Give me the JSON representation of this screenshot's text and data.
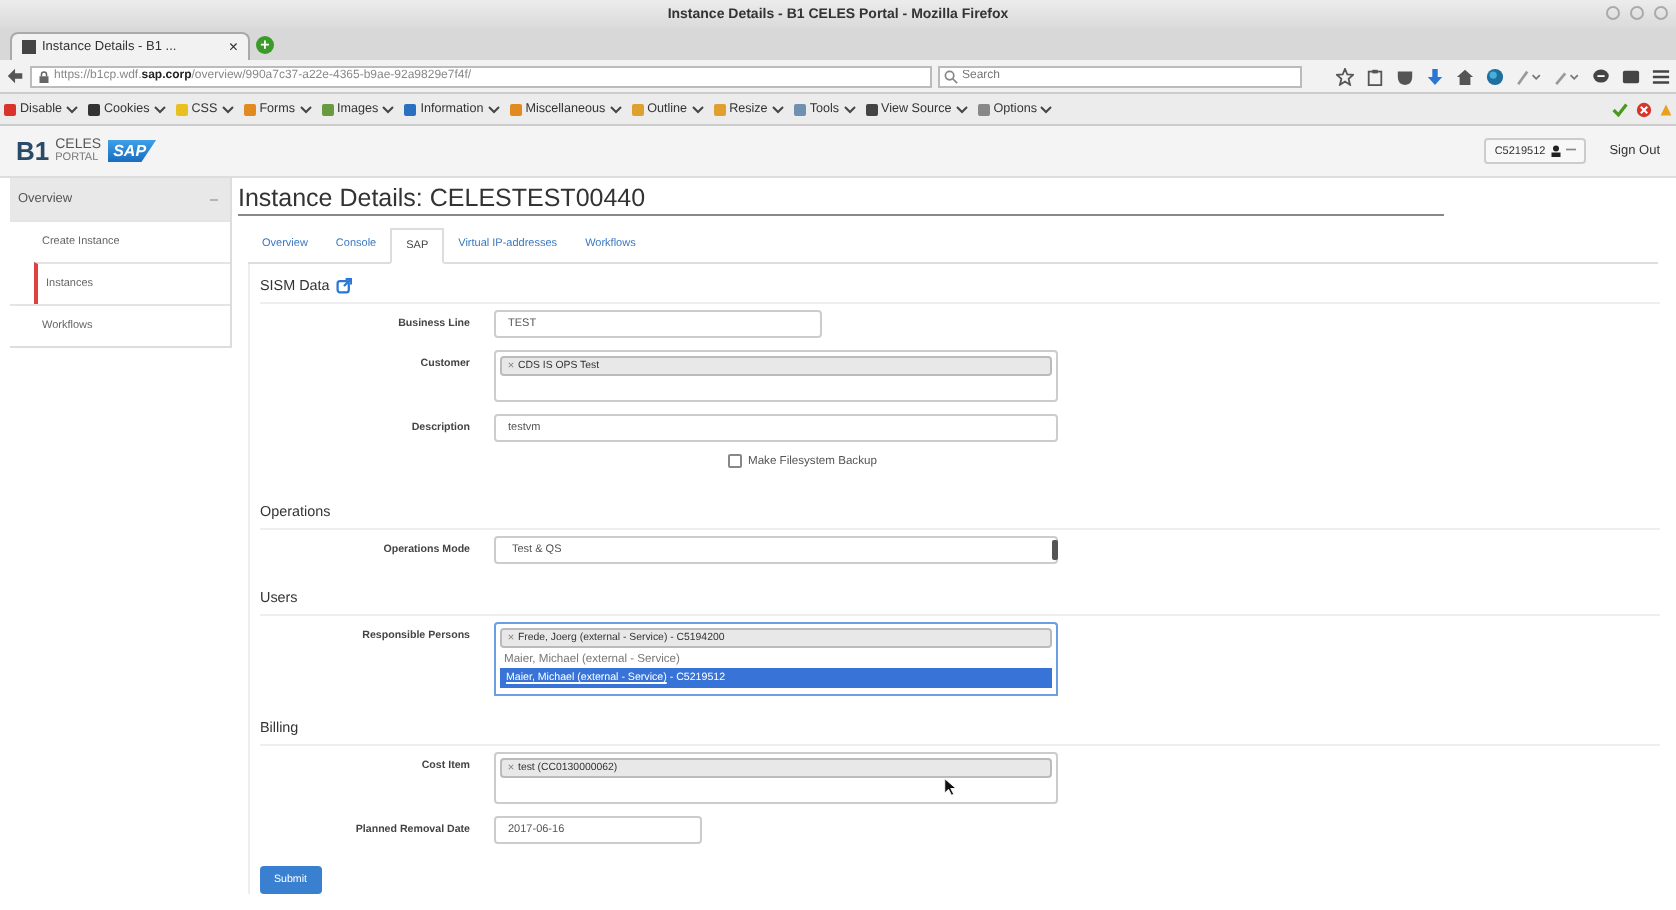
{
  "window": {
    "title": "Instance Details - B1 CELES Portal - Mozilla Firefox"
  },
  "browser_tab": {
    "title": "Instance Details - B1 ...",
    "close": "×",
    "new_tab": "+"
  },
  "url_bar": {
    "url": "https://b1cp.wdf.**sap.corp**/overview/990a7c37-a22e-4365-b9ae-92a9829e7f4f/"
  },
  "search": {
    "placeholder": "Search"
  },
  "dev_toolbar": [
    {
      "label": "Disable",
      "color": "#d9342b"
    },
    {
      "label": "Cookies",
      "color": "#333333"
    },
    {
      "label": "CSS",
      "color": "#e8c020"
    },
    {
      "label": "Forms",
      "color": "#e08a20"
    },
    {
      "label": "Images",
      "color": "#6a9a40"
    },
    {
      "label": "Information",
      "color": "#2a6fc0"
    },
    {
      "label": "Miscellaneous",
      "color": "#e08a20"
    },
    {
      "label": "Outline",
      "color": "#e0a030"
    },
    {
      "label": "Resize",
      "color": "#e0a030"
    },
    {
      "label": "Tools",
      "color": "#7090b0"
    },
    {
      "label": "View Source",
      "color": "#444444"
    },
    {
      "label": "Options",
      "color": "#888888"
    }
  ],
  "header": {
    "logo_main": "B1",
    "logo_top": "CELES",
    "logo_bottom": "PORTAL",
    "sap_logo": "SAP",
    "user": "C5219512",
    "sign_out": "Sign Out"
  },
  "sidebar": {
    "title": "Overview",
    "expanded": true,
    "items": [
      {
        "label": "Create Instance",
        "selected": false
      },
      {
        "label": "Instances",
        "selected": true
      },
      {
        "label": "Workflows",
        "selected": false
      }
    ]
  },
  "page_title": "Instance Details: CELESTEST00440",
  "tabs": [
    {
      "label": "Overview",
      "selected": false
    },
    {
      "label": "Console",
      "selected": false
    },
    {
      "label": "SAP",
      "selected": true
    },
    {
      "label": "Virtual IP-addresses",
      "selected": false
    },
    {
      "label": "Workflows",
      "selected": false
    }
  ],
  "sections": [
    {
      "title": "SISM Data",
      "external_link": true,
      "fields": [
        {
          "kind": "short_text",
          "label": "Business Line",
          "value": "TEST"
        },
        {
          "kind": "tags",
          "label": "Customer",
          "tags": [
            "CDS IS OPS Test"
          ]
        },
        {
          "kind": "text",
          "label": "Description",
          "value": "testvm"
        },
        {
          "kind": "checkbox",
          "text": "Make Filesystem Backup",
          "checked": false
        }
      ]
    },
    {
      "title": "Operations",
      "external_link": false,
      "fields": [
        {
          "kind": "select",
          "label": "Operations Mode",
          "value": "Test & QS"
        }
      ]
    },
    {
      "title": "Users",
      "external_link": false,
      "fields": [
        {
          "kind": "tags",
          "label": "Responsible Persons",
          "tags": [
            "Frede, Joerg (external - Service) - C5194200"
          ],
          "search_text": "Maier, Michael (external - Service)",
          "options": [
            {
              "match": "Maier, Michael (external - Service)",
              "rest": " - C5219512",
              "selected": true
            }
          ]
        }
      ]
    },
    {
      "title": "Billing",
      "external_link": false,
      "fields": [
        {
          "kind": "tags",
          "label": "Cost Item",
          "tags": [
            "test (CC0130000062)"
          ]
        },
        {
          "kind": "date",
          "label": "Planned Removal Date",
          "value": "2017-06-16"
        }
      ]
    }
  ],
  "submit": "Submit"
}
